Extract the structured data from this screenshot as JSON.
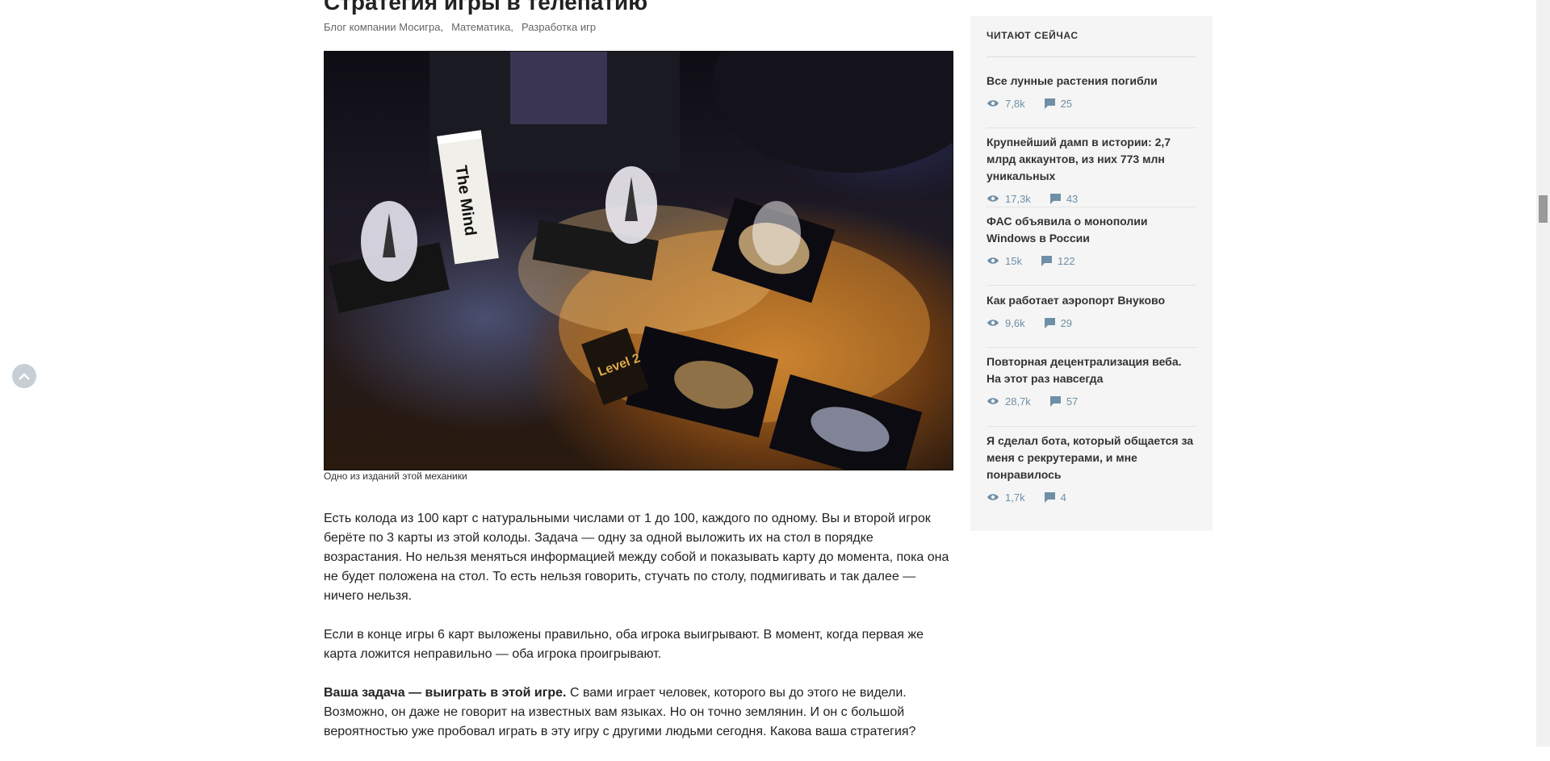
{
  "article": {
    "title": "Стратегия игры в телепатию",
    "hubs": [
      "Блог компании Мосигра,",
      "Математика,",
      "Разработка игр"
    ],
    "image_caption": "Одно из изданий этой механики",
    "image_box_text": "The Mind",
    "image_card_text": "Level 2",
    "paragraph1": "Есть колода из 100 карт с натуральными числами от 1 до 100, каждого по одному. Вы и второй игрок берёте по 3 карты из этой колоды. Задача — одну за одной выложить их на стол в порядке возрастания. Но нельзя меняться информацией между собой и показывать карту до момента, пока она не будет положена на стол. То есть нельзя говорить, стучать по столу, подмигивать и так далее — ничего нельзя.",
    "paragraph2": "Если в конце игры 6 карт выложены правильно, оба игрока выигрывают. В момент, когда первая же карта ложится неправильно — оба игрока проигрывают.",
    "paragraph3_bold": "Ваша задача — выиграть в этой игре.",
    "paragraph3_rest": " С вами играет человек, которого вы до этого не видели. Возможно, он даже не говорит на известных вам языках. Но он точно землянин. И он с большой вероятностью уже пробовал играть в эту игру с другими людьми сегодня. Какова ваша стратегия?"
  },
  "sidebar": {
    "title": "ЧИТАЮТ СЕЙЧАС",
    "items": [
      {
        "title": "Все лунные растения погибли",
        "views": "7,8k",
        "comments": "25"
      },
      {
        "title": "Крупнейший дамп в истории: 2,7 млрд аккаунтов, из них 773 млн уникальных",
        "views": "17,3k",
        "comments": "43"
      },
      {
        "title": "ФАС объявила о монополии Windows в России",
        "views": "15k",
        "comments": "122"
      },
      {
        "title": "Как работает аэропорт Внуково",
        "views": "9,6k",
        "comments": "29"
      },
      {
        "title": "Повторная децентрализация веба. На этот раз навсегда",
        "views": "28,7k",
        "comments": "57"
      },
      {
        "title": "Я сделал бота, который общается за меня с рекрутерами, и мне понравилось",
        "views": "1,7k",
        "comments": "4"
      }
    ]
  },
  "icons": {
    "views": "eye-icon",
    "comments": "comment-icon",
    "scroll_up": "chevron-up-icon"
  },
  "colors": {
    "stat": "#6f8fa6",
    "sidebar_bg": "#f5f5f5"
  }
}
